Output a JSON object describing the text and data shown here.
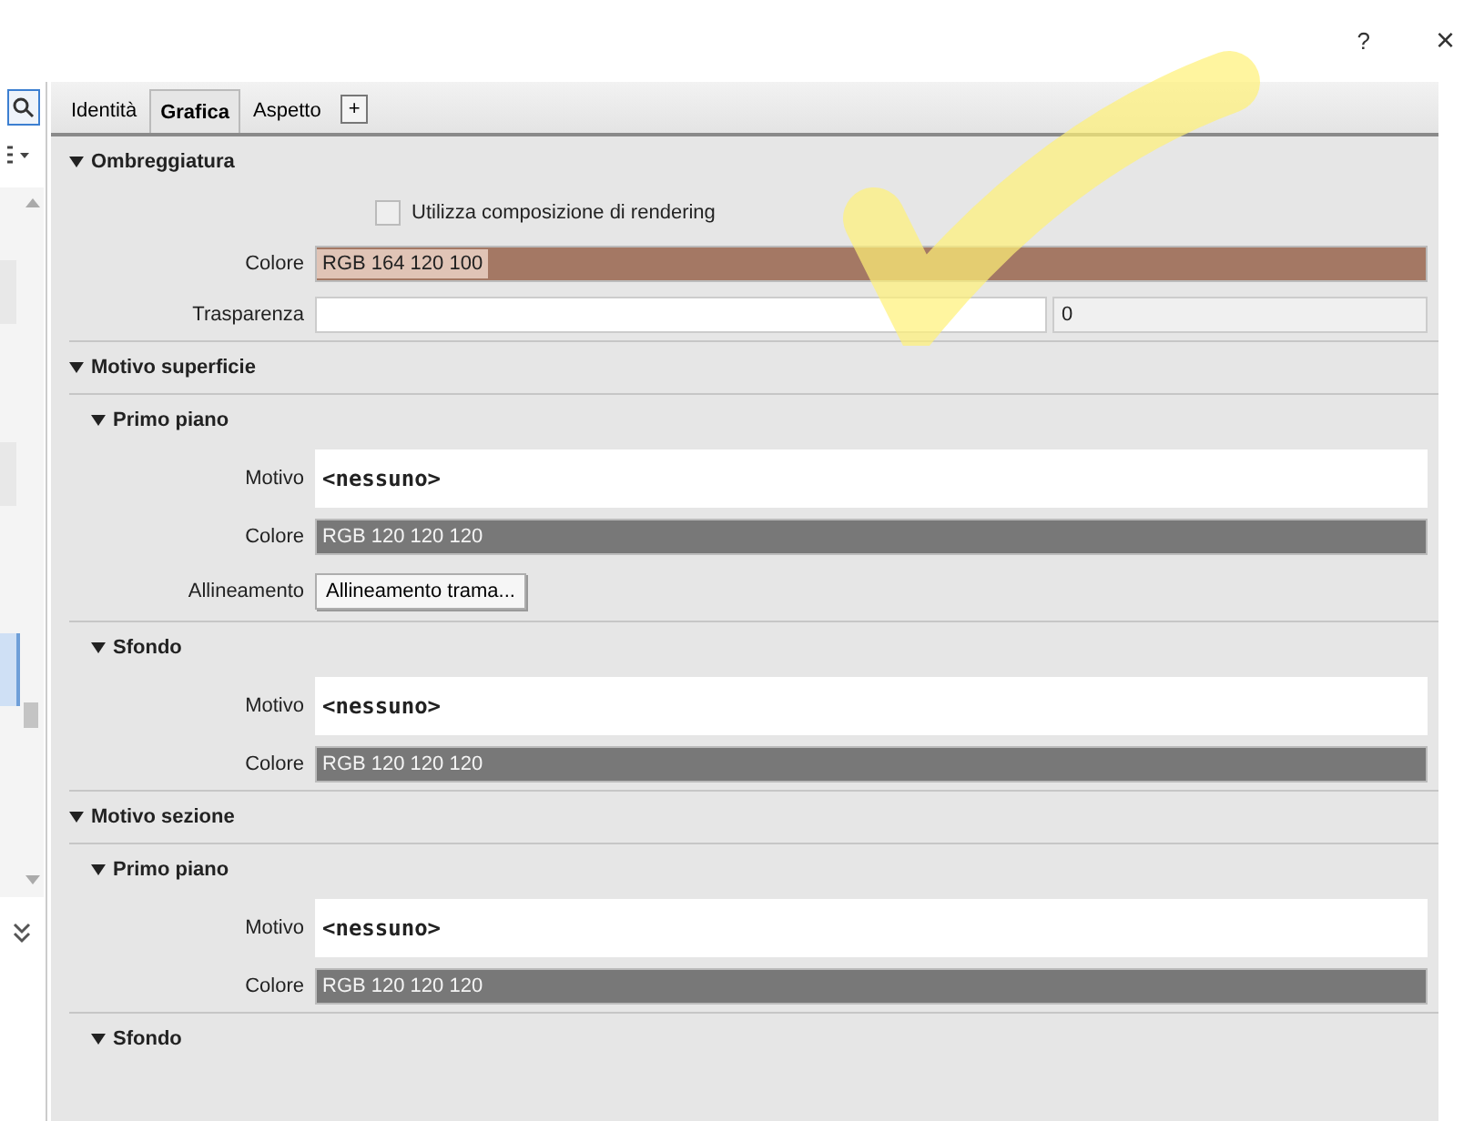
{
  "title_bar": {
    "help": "?",
    "close": "×"
  },
  "tabs": [
    {
      "label": "Identità",
      "selected": false
    },
    {
      "label": "Grafica",
      "selected": true
    },
    {
      "label": "Aspetto",
      "selected": false
    }
  ],
  "add_tab": "+",
  "sections": [
    {
      "title": "Ombreggiatura",
      "expanded": true,
      "rows": [
        {
          "kind": "checkbox",
          "label": "Utilizza composizione di rendering",
          "checked": false
        },
        {
          "kind": "color",
          "label": "Colore",
          "value": "RGB 164 120 100",
          "color": "#a47864",
          "selected": true
        },
        {
          "kind": "number",
          "label": "Trasparenza",
          "value": "0"
        }
      ]
    },
    {
      "title": "Motivo superficie",
      "expanded": true,
      "children": [
        {
          "title": "Primo piano",
          "expanded": true,
          "rows": [
            {
              "kind": "pattern",
              "label": "Motivo",
              "value": "<nessuno>"
            },
            {
              "kind": "color",
              "label": "Colore",
              "value": "RGB 120 120 120",
              "color": "#787878",
              "selected": false
            },
            {
              "kind": "button",
              "label": "Allineamento",
              "button": "Allineamento trama..."
            }
          ]
        },
        {
          "title": "Sfondo",
          "expanded": true,
          "rows": [
            {
              "kind": "pattern",
              "label": "Motivo",
              "value": "<nessuno>"
            },
            {
              "kind": "color",
              "label": "Colore",
              "value": "RGB 120 120 120",
              "color": "#787878",
              "selected": false
            }
          ]
        }
      ]
    },
    {
      "title": "Motivo sezione",
      "expanded": true,
      "children": [
        {
          "title": "Primo piano",
          "expanded": true,
          "rows": [
            {
              "kind": "pattern",
              "label": "Motivo",
              "value": "<nessuno>"
            },
            {
              "kind": "color",
              "label": "Colore",
              "value": "RGB 120 120 120",
              "color": "#787878",
              "selected": false
            }
          ]
        },
        {
          "title": "Sfondo",
          "expanded": true
        }
      ]
    }
  ]
}
